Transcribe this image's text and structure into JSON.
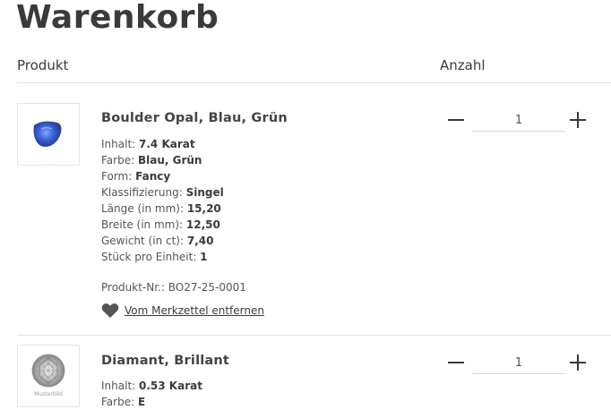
{
  "page": {
    "title": "Warenkorb"
  },
  "table": {
    "col_product": "Produkt",
    "col_quantity": "Anzahl"
  },
  "items": [
    {
      "name": "Boulder Opal, Blau, Grün",
      "quantity": "1",
      "properties": [
        {
          "label": "Inhalt:",
          "value": "7.4 Karat"
        },
        {
          "label": "Farbe:",
          "value": "Blau, Grün"
        },
        {
          "label": "Form:",
          "value": "Fancy"
        },
        {
          "label": "Klassifizierung:",
          "value": "Singel"
        },
        {
          "label": "Länge (in mm):",
          "value": "15,20"
        },
        {
          "label": "Breite (in mm):",
          "value": "12,50"
        },
        {
          "label": "Gewicht (in ct):",
          "value": "7,40"
        },
        {
          "label": "Stück pro Einheit:",
          "value": "1"
        }
      ],
      "sku": "Produkt-Nr.: BO27-25-0001",
      "wishlist_label": "Vom Merkzettel entfernen"
    },
    {
      "name": "Diamant, Brillant",
      "quantity": "1",
      "thumb_caption": "Musterbild",
      "properties": [
        {
          "label": "Inhalt:",
          "value": "0.53 Karat"
        },
        {
          "label": "Farbe:",
          "value": "E"
        }
      ]
    }
  ],
  "icons": {
    "minus": "minus-icon",
    "plus": "plus-icon",
    "heart": "heart-icon"
  },
  "colors": {
    "text": "#3a3a3a",
    "divider": "#e3e3e3"
  }
}
